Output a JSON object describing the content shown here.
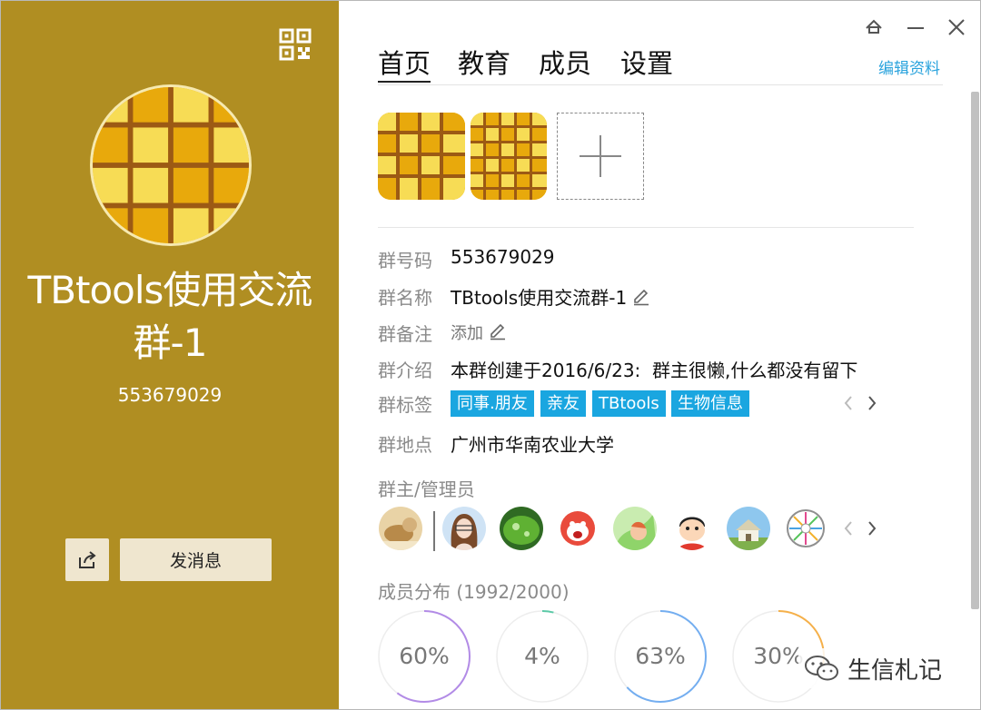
{
  "group": {
    "title": "TBtools使用交流群-1",
    "number": "553679029"
  },
  "left_panel": {
    "send_message_label": "发消息",
    "share_icon": "share-icon",
    "qr_icon": "qr-code-icon",
    "background_color": "#b08e22"
  },
  "window_controls": [
    "pin-icon",
    "minimize-icon",
    "close-icon"
  ],
  "tabs": [
    {
      "label": "首页",
      "active": true
    },
    {
      "label": "教育",
      "active": false
    },
    {
      "label": "成员",
      "active": false
    },
    {
      "label": "设置",
      "active": false
    }
  ],
  "edit_profile_label": "编辑资料",
  "info": {
    "number_label": "群号码",
    "number_value": "553679029",
    "name_label": "群名称",
    "name_value": "TBtools使用交流群-1",
    "remark_label": "群备注",
    "remark_value": "添加",
    "intro_label": "群介绍",
    "intro_value": "本群创建于2016/6/23:  群主很懒,什么都没有留下",
    "tags_label": "群标签",
    "tags": [
      "同事.朋友",
      "亲友",
      "TBtools",
      "生物信息"
    ],
    "location_label": "群地点",
    "location_value": "广州市华南农业大学"
  },
  "admins": {
    "label": "群主/管理员",
    "count_avatars": 8
  },
  "distribution": {
    "label": "成员分布",
    "count": "(1992/2000)",
    "rings": [
      {
        "text": "60%",
        "value": 0.6,
        "color": "#b28be6"
      },
      {
        "text": "4%",
        "value": 0.04,
        "color": "#5cc9a7"
      },
      {
        "text": "63%",
        "value": 0.63,
        "color": "#74aef0"
      },
      {
        "text": "30%",
        "value": 0.3,
        "color": "#f5b04a"
      }
    ]
  },
  "accent_color": "#1aa6e0",
  "watermark": "生信札记"
}
